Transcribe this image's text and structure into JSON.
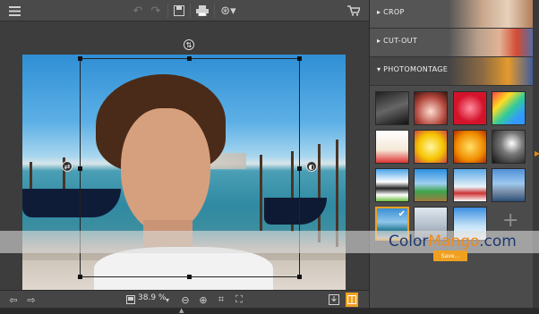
{
  "toolbar": {
    "icons": [
      "menu-icon",
      "undo-icon",
      "redo-icon",
      "save-icon",
      "print-icon",
      "share-icon",
      "cart-icon"
    ]
  },
  "panel": {
    "sections": [
      {
        "label": "CROP"
      },
      {
        "label": "CUT-OUT"
      },
      {
        "label": "PHOTOMONTAGE"
      }
    ],
    "save_label": "Save..."
  },
  "bottom": {
    "zoom": "38.9 %"
  },
  "watermark": {
    "part1": "Color",
    "part2": "Mango",
    "part3": ".com"
  },
  "colors": {
    "accent": "#f0a020",
    "panel_bg": "#4b4b4b",
    "toolbar_bg": "#4a4a4a"
  }
}
